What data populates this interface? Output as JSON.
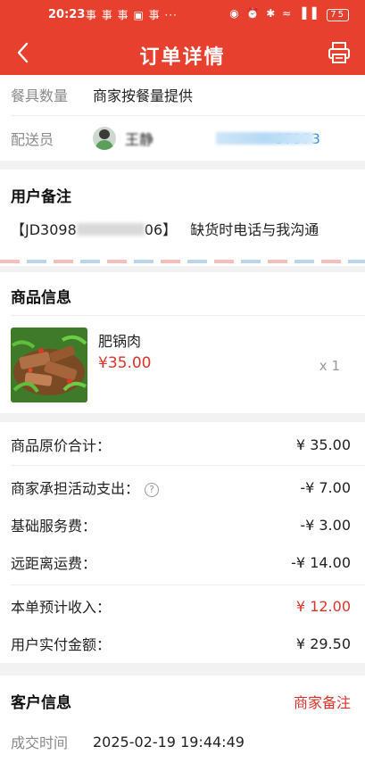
{
  "status_bar": {
    "time": "20:23",
    "notifications": "事 事 事 ▣ 事 ···",
    "system_icons": "◉ ⏰ ✱ ≈ ▐▐",
    "battery": "75"
  },
  "nav": {
    "title": "订单详情"
  },
  "order_info": {
    "tableware_label": "餐具数量",
    "tableware_value": "商家按餐量提供",
    "courier_label": "配送员",
    "courier_name": "王静",
    "courier_phone": "97973"
  },
  "remark": {
    "title": "用户备注",
    "order_prefix": "【JD3098",
    "order_suffix": "06】",
    "text": "缺货时电话与我沟通"
  },
  "products": {
    "title": "商品信息",
    "items": [
      {
        "name": "肥锅肉",
        "price": "¥35.00",
        "qty": "x 1"
      }
    ]
  },
  "fees": {
    "rows": [
      {
        "label": "商品原价合计：",
        "amount": "¥ 35.00"
      },
      {
        "label": "商家承担活动支出：",
        "amount": "-¥ 7.00"
      },
      {
        "label": "基础服务费：",
        "amount": "-¥ 3.00"
      },
      {
        "label": "远距离运费：",
        "amount": "-¥ 14.00"
      },
      {
        "label": "本单预计收入：",
        "amount": "¥ 12.00"
      },
      {
        "label": "用户实付金额：",
        "amount": "¥ 29.50"
      }
    ],
    "help_symbol": "?"
  },
  "customer": {
    "title": "客户信息",
    "merchant_note_link": "商家备注",
    "deal_time_label": "成交时间",
    "deal_time_value": "2025-02-19 19:44:49"
  },
  "colors": {
    "brand_red": "#e8402f",
    "price_red": "#d8352a",
    "gray_label": "#8a8a8a"
  }
}
